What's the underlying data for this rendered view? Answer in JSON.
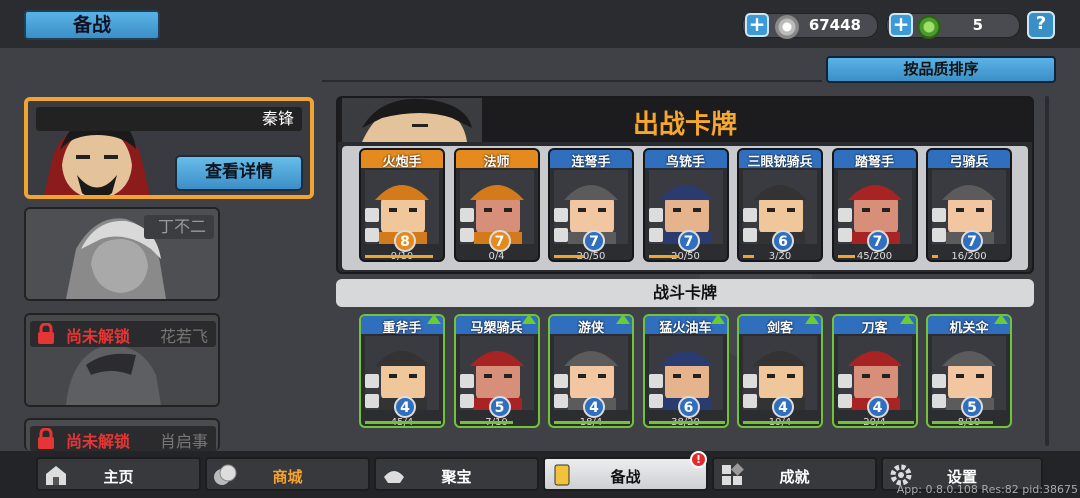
{
  "header": {
    "title": "备战",
    "currency_coins": "67448",
    "currency_gems": "5",
    "help": "?"
  },
  "sort_button": "按品质排序",
  "heroes": [
    {
      "name": "秦锋",
      "detail_label": "查看详情"
    },
    {
      "name": "丁不二"
    },
    {
      "name": "花若飞",
      "lock_label": "尚未解锁"
    },
    {
      "name": "肖启事",
      "lock_label": "尚未解锁"
    }
  ],
  "deploy_title": "出战卡牌",
  "deploy_cards": [
    {
      "name": "火炮手",
      "level": "8",
      "count": "9/10",
      "progress": 0.9,
      "color": "#e48a1e"
    },
    {
      "name": "法师",
      "level": "7",
      "count": "0/4",
      "progress": 0.0,
      "color": "#e48a1e"
    },
    {
      "name": "连弩手",
      "level": "7",
      "count": "20/50",
      "progress": 0.4,
      "color": "#2f6fbd"
    },
    {
      "name": "鸟铳手",
      "level": "7",
      "count": "20/50",
      "progress": 0.4,
      "color": "#2f6fbd"
    },
    {
      "name": "三眼铳骑兵",
      "level": "6",
      "count": "3/20",
      "progress": 0.15,
      "color": "#2f6fbd"
    },
    {
      "name": "踏弩手",
      "level": "7",
      "count": "45/200",
      "progress": 0.22,
      "color": "#2f6fbd"
    },
    {
      "name": "弓骑兵",
      "level": "7",
      "count": "16/200",
      "progress": 0.08,
      "color": "#2f6fbd"
    }
  ],
  "battle_title": "战斗卡牌",
  "battle_cards": [
    {
      "name": "重斧手",
      "level": "4",
      "count": "45/4",
      "progress": 1.0,
      "color": "#2f6fbd"
    },
    {
      "name": "马槊骑兵",
      "level": "5",
      "count": "7/10",
      "progress": 0.7,
      "color": "#2f6fbd"
    },
    {
      "name": "游侠",
      "level": "4",
      "count": "18/4",
      "progress": 1.0,
      "color": "#2f6fbd"
    },
    {
      "name": "猛火油车",
      "level": "6",
      "count": "38/20",
      "progress": 1.0,
      "color": "#2f6fbd"
    },
    {
      "name": "剑客",
      "level": "4",
      "count": "19/4",
      "progress": 1.0,
      "color": "#2f6fbd"
    },
    {
      "name": "刀客",
      "level": "4",
      "count": "20/4",
      "progress": 1.0,
      "color": "#2f6fbd"
    },
    {
      "name": "机关伞",
      "level": "5",
      "count": "8/10",
      "progress": 0.8,
      "color": "#2f6fbd"
    }
  ],
  "nav": [
    {
      "label": "主页",
      "icon": "home-icon"
    },
    {
      "label": "商城",
      "icon": "shop-icon"
    },
    {
      "label": "聚宝",
      "icon": "treasure-icon"
    },
    {
      "label": "备战",
      "icon": "cards-icon"
    },
    {
      "label": "成就",
      "icon": "achievement-icon"
    },
    {
      "label": "设置",
      "icon": "gear-icon"
    }
  ],
  "nav_badge": "!",
  "version": "App: 0.8.0.108 Res:82 pid:38675",
  "colors": {
    "accent_orange": "#f7a72e",
    "accent_blue": "#3b8fc7",
    "lock_red": "#e53535",
    "upgrade_green": "#72c437"
  }
}
